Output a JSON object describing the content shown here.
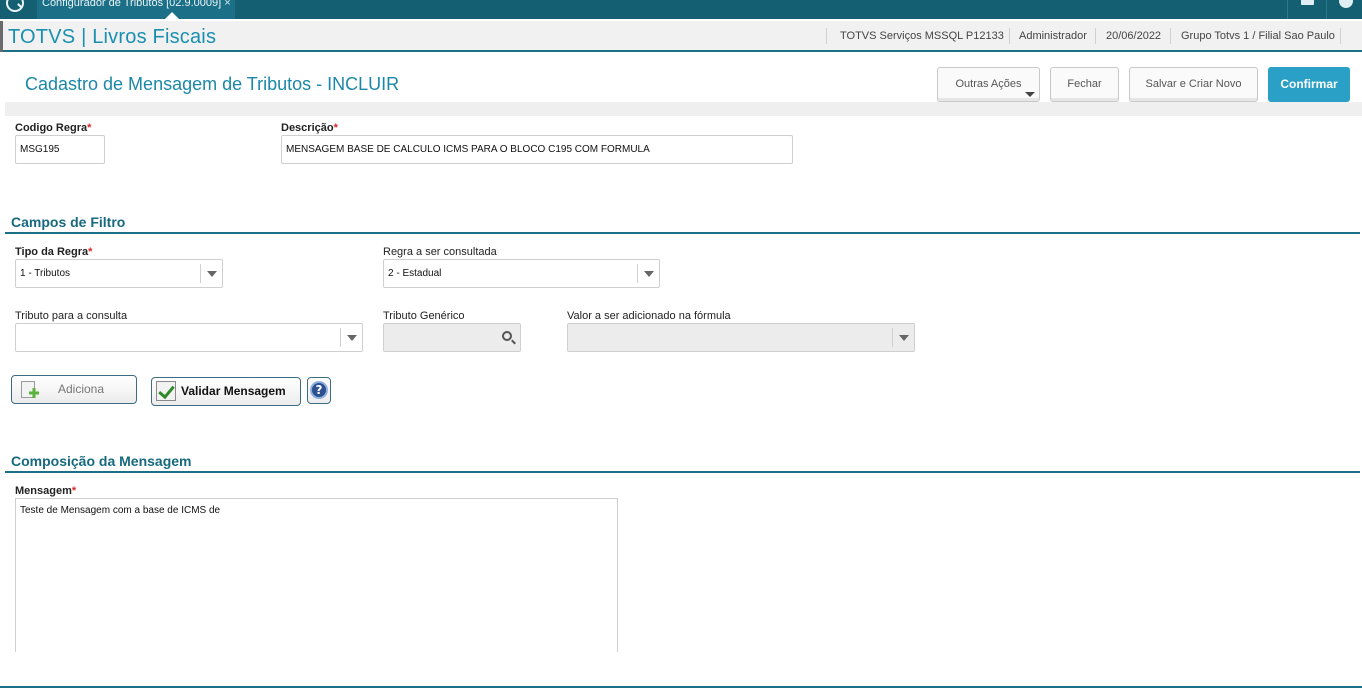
{
  "window": {
    "tab_title": "Configurador de Tributos [02.9.0009]",
    "tab_close": "×"
  },
  "header": {
    "app_title": "TOTVS | Livros Fiscais",
    "environment": "TOTVS Serviços MSSQL P12133",
    "user": "Administrador",
    "date": "20/06/2022",
    "branch": "Grupo Totvs 1 / Filial Sao Paulo"
  },
  "page": {
    "title": "Cadastro de Mensagem de Tributos - INCLUIR"
  },
  "actions": {
    "other_actions": "Outras Ações",
    "close": "Fechar",
    "save_new": "Salvar e Criar Novo",
    "confirm": "Confirmar"
  },
  "form": {
    "codigo_label": "Codigo Regra",
    "codigo_value": "MSG195",
    "descricao_label": "Descrição",
    "descricao_value": "MENSAGEM BASE DE CALCULO ICMS PARA O BLOCO C195 COM FORMULA",
    "required_mark": "*"
  },
  "filters": {
    "section_title": "Campos de Filtro",
    "tipo_label": "Tipo da Regra",
    "tipo_value": "1 - Tributos",
    "regra_label": "Regra a ser consultada",
    "regra_value": "2 - Estadual",
    "tributo_label": "Tributo para a consulta",
    "tributo_value": "",
    "generico_label": "Tributo Genérico",
    "valor_label": "Valor a ser adicionado na fórmula",
    "valor_value": ""
  },
  "buttons": {
    "adiciona": "Adiciona",
    "validar": "Validar Mensagem",
    "help": "?"
  },
  "composition": {
    "section_title": "Composição da Mensagem",
    "mensagem_label": "Mensagem",
    "mensagem_value": "Teste de Mensagem com a base de ICMS de"
  },
  "colors": {
    "brand_dark": "#155f73",
    "accent": "#1b88a8",
    "primary_button": "#2aa0c6",
    "required": "#d9262a"
  }
}
